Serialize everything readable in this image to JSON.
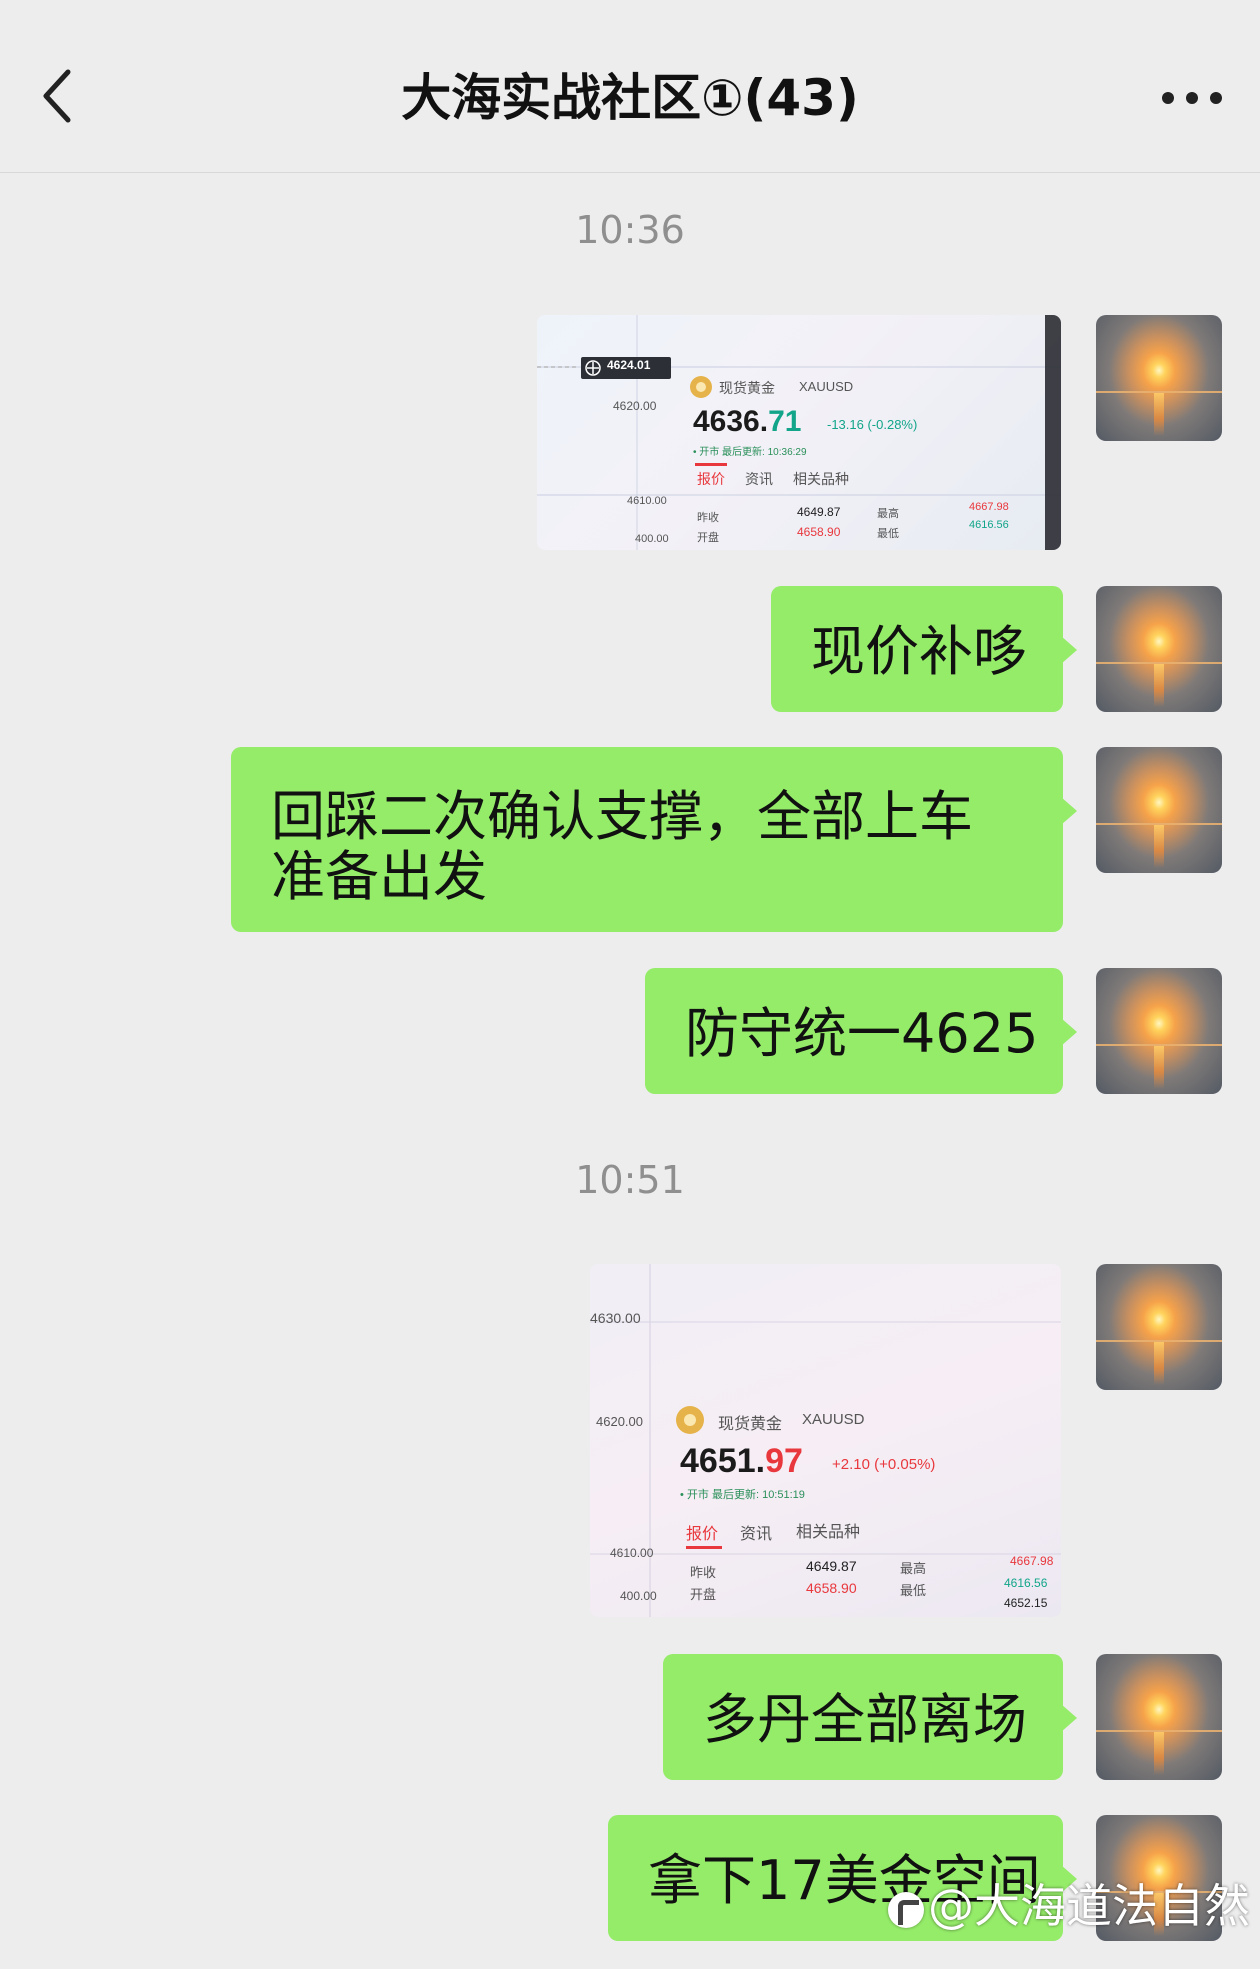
{
  "header": {
    "title": "大海实战社区①(43)",
    "back_icon": "chevron-left-icon",
    "more_icon": "more-dots-icon"
  },
  "timestamps": [
    "10:36",
    "10:51"
  ],
  "screenshots": [
    {
      "chart_price_left": "4620.00",
      "chart_price_left2": "4610.00",
      "chart_price_left3": "400.00",
      "marker_price": "4624.01",
      "symbol_cn": "现货黄金",
      "symbol": "XAUUSD",
      "price_main": "4636.",
      "price_decimal": "71",
      "change": "-13.16 (-0.28%)",
      "status": "• 开市 最后更新: 10:36:29",
      "tabs": [
        "报价",
        "资讯",
        "相关品种"
      ],
      "row1": [
        "昨收",
        "4649.87",
        "最高",
        "4667.98"
      ],
      "row2": [
        "开盘",
        "4658.90",
        "最低",
        "4616.56"
      ]
    },
    {
      "chart_price_top": "4630.00",
      "chart_price_left": "4620.00",
      "chart_price_left2": "4610.00",
      "chart_price_left3": "400.00",
      "symbol_cn": "现货黄金",
      "symbol": "XAUUSD",
      "price_main": "4651.",
      "price_decimal": "97",
      "change": "+2.10 (+0.05%)",
      "status": "• 开市 最后更新: 10:51:19",
      "tabs": [
        "报价",
        "资讯",
        "相关品种"
      ],
      "row1": [
        "昨收",
        "4649.87",
        "最高",
        "4667.98"
      ],
      "row2": [
        "开盘",
        "4658.90",
        "最低",
        "4616.56"
      ],
      "row3_right": "4652.15"
    }
  ],
  "messages": [
    "现价补哆",
    "回踩二次确认支撑，全部上车准备出发",
    "防守统一4625",
    "多丹全部离场",
    "拿下17美金空间"
  ],
  "watermark": "@大海道法自然",
  "colors": {
    "bubble": "#95ec69",
    "background": "#ededed",
    "down": "#12a58a",
    "up": "#e8383d"
  }
}
